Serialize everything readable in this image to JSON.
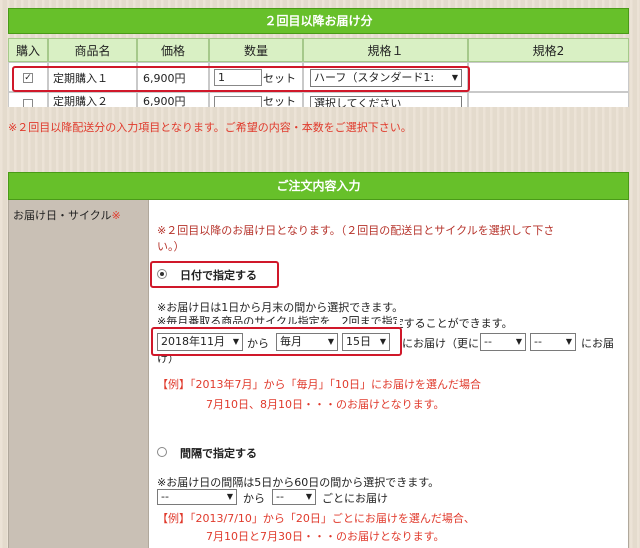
{
  "section1": {
    "title": "２回目以降お届け分",
    "headers": [
      "購入",
      "商品名",
      "価格",
      "数量",
      "規格１",
      "規格2"
    ],
    "rows": [
      {
        "checked": true,
        "name": "定期購入１",
        "price": "6,900円",
        "qty": "1",
        "unit": "セット",
        "spec": "ハーフ（スタンダード1:"
      },
      {
        "checked": false,
        "name": "定期購入２",
        "price": "6,900円",
        "qty": "",
        "unit": "セット",
        "spec": "選択してください"
      }
    ],
    "note": "※２回目以降配送分の入力項目となります。ご希望の内容・本数をご選択下さい。"
  },
  "section2": {
    "title": "ご注文内容入力",
    "left_label": "お届け日・サイクル",
    "required_mark": "※",
    "intro_line1": "※２回目以降のお届け日となります。（２回目の配送日とサイクルを選択して下さ",
    "intro_line2": "い。）",
    "option_date": {
      "label": "日付で指定する",
      "selected": true,
      "line1": "※お届け日は1日から月末の間から選択できます。",
      "line2": "※毎月番取る商品のサイクル指定を　2回まで指定することができます。",
      "month_select": "2018年11月",
      "from_text": "から",
      "cycle_select": "毎月",
      "day_select": "15日",
      "delivery_text": "にお届け（更に",
      "extra_select1": "--",
      "extra_select2": "--",
      "tail_text": "にお届",
      "wrap_text": "け）",
      "example_line1": "【例】「2013年7月」から「毎月」「10日」にお届けを選んだ場合",
      "example_line2": "7月10日、8月10日・・・のお届けとなります。"
    },
    "option_interval": {
      "label": "間隔で指定する",
      "selected": false,
      "line1": "※お届け日の間隔は5日から60日の間から選択できます。",
      "select1": "--",
      "from_text": "から",
      "select2": "--",
      "suffix_text": "ごとにお届け",
      "example_line1": "【例】「2013/7/10」から「20日」ごとにお届けを選んだ場合、",
      "example_line2": "7月10日と7月30日・・・のお届けとなります。"
    }
  },
  "colors": {
    "green_bar": "#67c02a",
    "header_cell": "#d9f0c4",
    "highlight_frame": "#d0182a",
    "note_red": "#e03a2c",
    "left_column": "#c9c0b5"
  }
}
